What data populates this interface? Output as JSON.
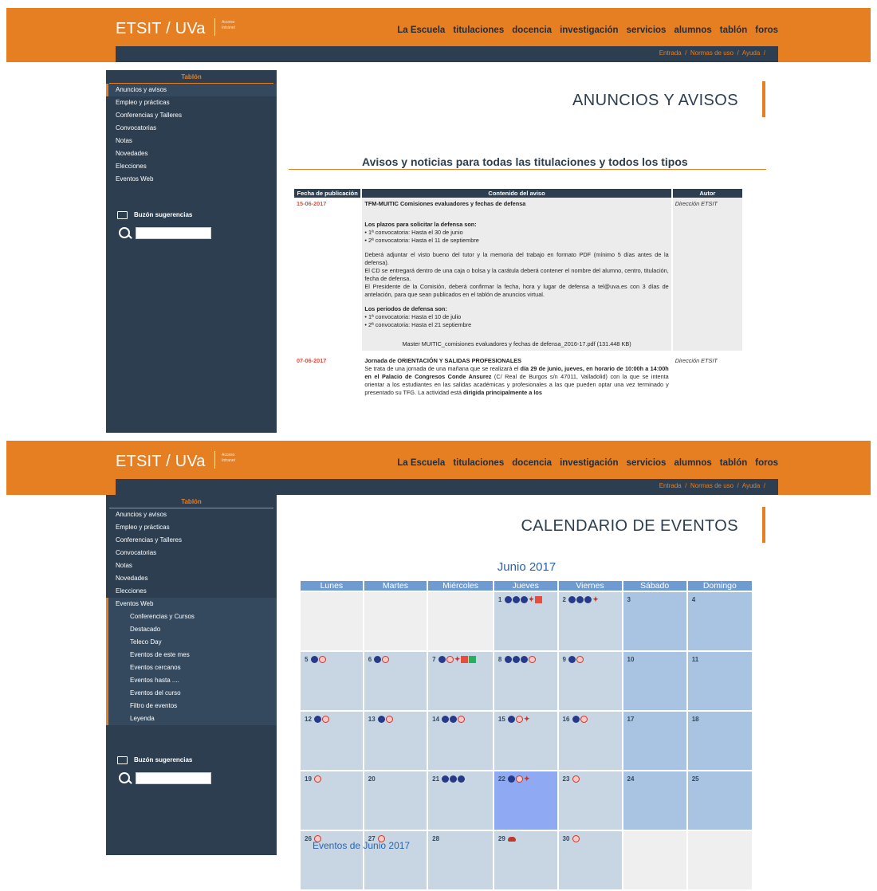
{
  "header": {
    "brand": "ETSIT / UVa",
    "brand_sub_1": "Acceso",
    "brand_sub_2": "Intranet",
    "nav": [
      "La Escuela",
      "titulaciones",
      "docencia",
      "investigación",
      "servicios",
      "alumnos",
      "tablón",
      "foros"
    ],
    "subnav": [
      "Entrada",
      "Normas de uso",
      "Ayuda"
    ]
  },
  "sidebar": {
    "title": "Tablón",
    "items": [
      "Anuncios y avisos",
      "Empleo y prácticas",
      "Conferencias y Talleres",
      "Convocatorias",
      "Notas",
      "Novedades",
      "Elecciones",
      "Eventos Web"
    ],
    "eventos_sub": [
      "Conferencias y Cursos",
      "Destacado",
      "Teleco Day",
      "Eventos de este mes",
      "Eventos cercanos",
      "Eventos hasta ....",
      "Eventos del curso",
      "Filtro de eventos",
      "Leyenda"
    ],
    "suggestions": "Buzón sugerencias"
  },
  "page1": {
    "title": "ANUNCIOS Y AVISOS",
    "section_title": "Avisos y noticias para todas las titulaciones y todos los tipos",
    "columns": [
      "Fecha de publicación",
      "Contenido del aviso",
      "Autor"
    ],
    "notices": [
      {
        "date": "15-06-2017",
        "title": "TFM-MUITIC Comisiones evaluadores y fechas de defensa",
        "h1": "Los plazos para solicitar la defensa son:",
        "l1": "• 1ª convocatoria: Hasta el 30 de junio",
        "l2": "• 2ª convocatoria: Hasta el 11 de septiembre",
        "p1": "Deberá adjuntar el visto bueno del tutor y la memoria del trabajo en formato PDF (mínimo 5 días antes de la defensa).",
        "p2": "El CD se entregará dentro de una caja o bolsa y la carátula deberá contener el nombre del alumno, centro, titulación, fecha de defensa.",
        "p3": "El Presidente de la Comisión, deberá confirmar la fecha, hora y lugar de defensa a tel@uva.es con 3 días de antelación, para que sean publicados en el tablón de anuncios virtual.",
        "h2": "Los periodos de defensa son:",
        "l3": "• 1ª convocatoria: Hasta el 10 de julio",
        "l4": "• 2ª convocatoria: Hasta el 21 septiembre",
        "attachment": "Master MUITIC_comisiones evaluadores y fechas de defensa_2016-17.pdf (131.448 KB)",
        "author": "Dirección ETSIT"
      },
      {
        "date": "07-06-2017",
        "title": "Jornada de ORIENTACIÓN Y SALIDAS PROFESIONALES",
        "t1": "Se trata de una jornada de una mañana que se realizará el ",
        "b1": "día 29 de junio, jueves, en horario de 10:00h a 14:00h en el Palacio de Congresos Conde Ansurez",
        "t2": " (C/ Real de Burgos s/n 47011, Valladolid) con la que se intenta orientar a los estudiantes en las salidas académicas y profesionales a las que pueden optar una vez terminado y presentado su TFG. La actividad está ",
        "b2": "dirigida principalmente a los",
        "author": "Dirección ETSIT"
      }
    ]
  },
  "page2": {
    "title": "CALENDARIO DE EVENTOS",
    "calendar_title": "Junio 2017",
    "weekdays": [
      "Lunes",
      "Martes",
      "Miércoles",
      "Jueves",
      "Viernes",
      "Sábado",
      "Domingo"
    ],
    "events_link": "Eventos de Junio 2017"
  }
}
